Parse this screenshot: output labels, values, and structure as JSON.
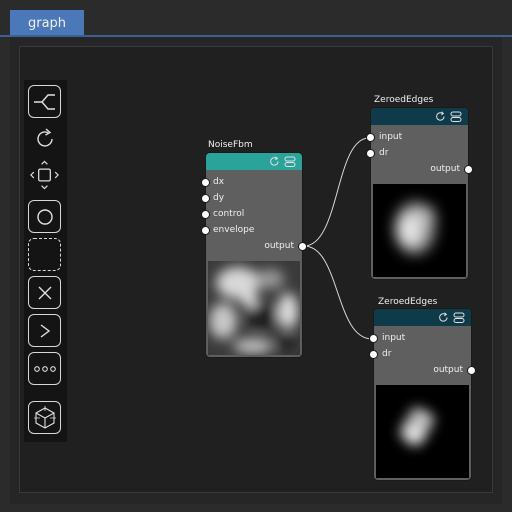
{
  "tab": {
    "label": "graph"
  },
  "toolbar": {
    "tools": [
      "link-icon",
      "reload-icon",
      "fit-view-icon",
      "circle-select-icon",
      "dashed-select-icon",
      "delete-icon",
      "run-icon",
      "more-icon",
      "cube-icon"
    ]
  },
  "nodes": {
    "noise": {
      "title": "NoiseFbm",
      "inputs": [
        "dx",
        "dy",
        "control",
        "envelope"
      ],
      "output": "output",
      "header_color": "#2aa39a"
    },
    "zeroed1": {
      "title": "ZeroedEdges",
      "inputs": [
        "input",
        "dr"
      ],
      "output": "output",
      "header_color": "#0f3a4a"
    },
    "zeroed2": {
      "title": "ZeroedEdges",
      "inputs": [
        "input",
        "dr"
      ],
      "output": "output",
      "header_color": "#0f3a4a"
    }
  }
}
